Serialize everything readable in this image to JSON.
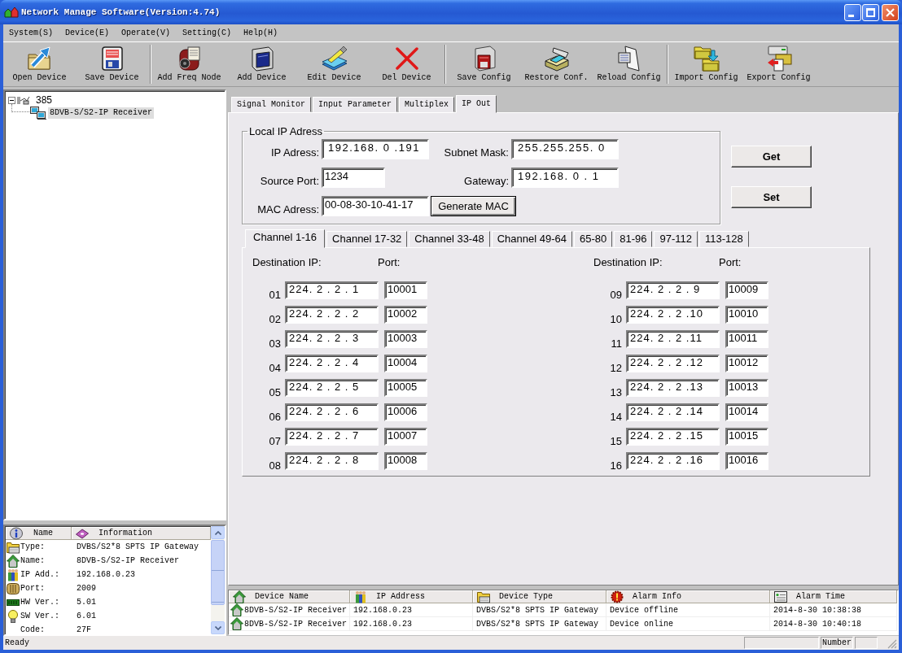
{
  "window": {
    "title": "Network Manage Software(Version:4.74)"
  },
  "menu": [
    "System(S)",
    "Device(E)",
    "Operate(V)",
    "Setting(C)",
    "Help(H)"
  ],
  "toolbar": [
    [
      {
        "label": "Open Device",
        "kind": "open"
      },
      {
        "label": "Save Device",
        "kind": "save"
      }
    ],
    [
      {
        "label": "Add Freq Node",
        "kind": "add_node"
      },
      {
        "label": "Add Device",
        "kind": "add_device"
      },
      {
        "label": "Edit Device",
        "kind": "edit"
      },
      {
        "label": "Del Device",
        "kind": "delete"
      }
    ],
    [
      {
        "label": "Save Config",
        "kind": "save_config"
      },
      {
        "label": "Restore Conf.",
        "kind": "restore"
      },
      {
        "label": "Reload Config",
        "kind": "reload"
      }
    ],
    [
      {
        "label": "Import Config",
        "kind": "import"
      },
      {
        "label": "Export Config",
        "kind": "export"
      }
    ]
  ],
  "tree": [
    {
      "label": "385",
      "expanded": true,
      "selected": false,
      "children": [
        {
          "label": "8DVB-S/S2-IP Receiver",
          "selected": true
        }
      ]
    }
  ],
  "info_panel": {
    "columns": [
      {
        "label": "Name",
        "kind": "info"
      },
      {
        "label": "Information",
        "kind": "disk"
      }
    ],
    "rows": [
      {
        "kind": "type",
        "name": "Type:",
        "value": "DVBS/S2*8 SPTS IP Gateway"
      },
      {
        "kind": "name",
        "name": "Name:",
        "value": "8DVB-S/S2-IP Receiver"
      },
      {
        "kind": "ip",
        "name": "IP Add.:",
        "value": "192.168.0.23"
      },
      {
        "kind": "port",
        "name": "Port:",
        "value": "2009"
      },
      {
        "kind": "hw",
        "name": "HW Ver.:",
        "value": "5.01"
      },
      {
        "kind": "sw",
        "name": "SW Ver.:",
        "value": "6.01"
      },
      {
        "kind": "code",
        "name": "Code:",
        "value": "27F"
      }
    ]
  },
  "main_tabs": [
    {
      "label": "Signal Monitor",
      "selected": false
    },
    {
      "label": "Input Parameter",
      "selected": false
    },
    {
      "label": "Multiplex",
      "selected": false
    },
    {
      "label": "IP Out",
      "selected": true
    }
  ],
  "local_ip": {
    "title": "Local IP Adress",
    "fields": [
      {
        "label": "IP Adress:",
        "value": "192.168. 0 .191",
        "kind": "ip"
      },
      {
        "label": "Subnet Mask:",
        "value": "255.255.255. 0",
        "kind": "ip"
      },
      {
        "label": "Source Port:",
        "value": "1234",
        "kind": "port"
      },
      {
        "label": "Gateway:",
        "value": "192.168. 0 . 1",
        "kind": "ip"
      },
      {
        "label": "MAC Adress:",
        "value": "00-08-30-10-41-17",
        "kind": "mac"
      }
    ],
    "generate_button": "Generate MAC"
  },
  "side_buttons": [
    "Get",
    "Set"
  ],
  "channel_tabs": [
    {
      "label": "Channel 1-16",
      "selected": true
    },
    {
      "label": "Channel 17-32",
      "selected": false
    },
    {
      "label": "Channel 33-48",
      "selected": false
    },
    {
      "label": "Channel 49-64",
      "selected": false
    },
    {
      "label": "65-80",
      "selected": false
    },
    {
      "label": "81-96",
      "selected": false
    },
    {
      "label": "97-112",
      "selected": false
    },
    {
      "label": "113-128",
      "selected": false
    }
  ],
  "channels": [
    {
      "headers": [
        "Destination IP:",
        "Port:"
      ],
      "rows": [
        {
          "number": "01",
          "ip": "224. 2 . 2 . 1",
          "port": "10001"
        },
        {
          "number": "02",
          "ip": "224. 2 . 2 . 2",
          "port": "10002"
        },
        {
          "number": "03",
          "ip": "224. 2 . 2 . 3",
          "port": "10003"
        },
        {
          "number": "04",
          "ip": "224. 2 . 2 . 4",
          "port": "10004"
        },
        {
          "number": "05",
          "ip": "224. 2 . 2 . 5",
          "port": "10005"
        },
        {
          "number": "06",
          "ip": "224. 2 . 2 . 6",
          "port": "10006"
        },
        {
          "number": "07",
          "ip": "224. 2 . 2 . 7",
          "port": "10007"
        },
        {
          "number": "08",
          "ip": "224. 2 . 2 . 8",
          "port": "10008"
        }
      ]
    },
    {
      "headers": [
        "Destination IP:",
        "Port:"
      ],
      "rows": [
        {
          "number": "09",
          "ip": "224. 2 . 2 . 9",
          "port": "10009"
        },
        {
          "number": "10",
          "ip": "224. 2 . 2 .10",
          "port": "10010"
        },
        {
          "number": "11",
          "ip": "224. 2 . 2 .11",
          "port": "10011"
        },
        {
          "number": "12",
          "ip": "224. 2 . 2 .12",
          "port": "10012"
        },
        {
          "number": "13",
          "ip": "224. 2 . 2 .13",
          "port": "10013"
        },
        {
          "number": "14",
          "ip": "224. 2 . 2 .14",
          "port": "10014"
        },
        {
          "number": "15",
          "ip": "224. 2 . 2 .15",
          "port": "10015"
        },
        {
          "number": "16",
          "ip": "224. 2 . 2 .16",
          "port": "10016"
        }
      ]
    }
  ],
  "alarm_table": {
    "columns": [
      {
        "label": "Device Name",
        "kind": "device"
      },
      {
        "label": "IP Address",
        "kind": "address"
      },
      {
        "label": "Device Type",
        "kind": "device_type"
      },
      {
        "label": "Alarm Info",
        "kind": "alarm"
      },
      {
        "label": "Alarm Time",
        "kind": "time"
      }
    ],
    "rows": [
      [
        "8DVB-S/S2-IP Receiver",
        "192.168.0.23",
        "DVBS/S2*8 SPTS IP Gateway",
        "Device offline",
        "2014-8-30 10:38:38"
      ],
      [
        "8DVB-S/S2-IP Receiver",
        "192.168.0.23",
        "DVBS/S2*8 SPTS IP Gateway",
        "Device online",
        "2014-8-30 10:40:18"
      ]
    ]
  },
  "status_bar": {
    "message": "Ready",
    "label": "Number"
  }
}
